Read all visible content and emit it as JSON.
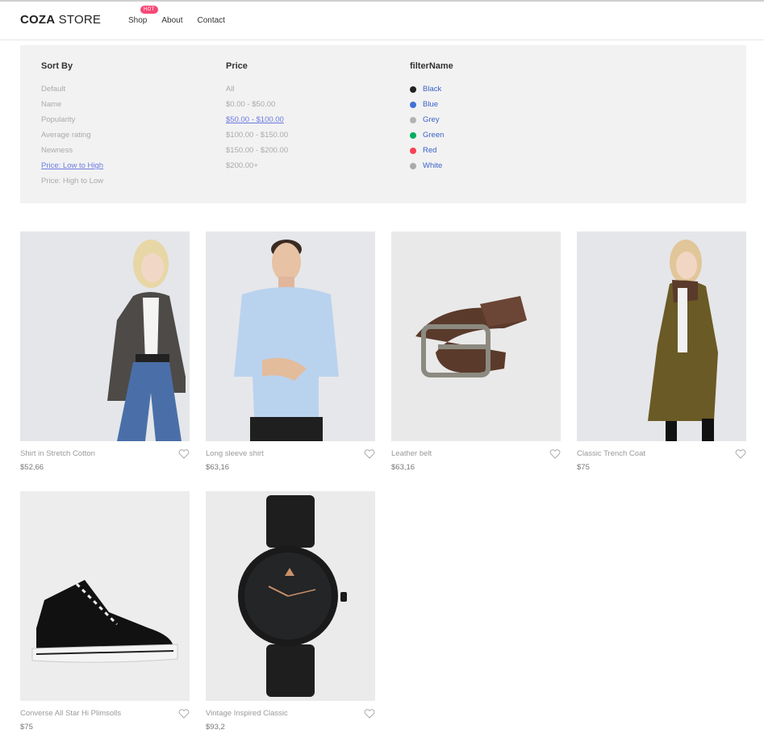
{
  "header": {
    "logo_bold": "COZA",
    "logo_light": " STORE",
    "nav": [
      {
        "label": "Shop",
        "badge": "HOT"
      },
      {
        "label": "About"
      },
      {
        "label": "Contact"
      }
    ]
  },
  "filters": {
    "sort": {
      "title": "Sort By",
      "options": [
        "Default",
        "Name",
        "Popularity",
        "Average rating",
        "Newness",
        "Price: Low to High",
        "Price: High to Low"
      ],
      "active": "Price: Low to High"
    },
    "price": {
      "title": "Price",
      "options": [
        "All",
        "$0.00 - $50.00",
        "$50.00 - $100.00",
        "$100.00 - $150.00",
        "$150.00 - $200.00",
        "$200.00+"
      ],
      "active": "$50.00 - $100.00"
    },
    "color": {
      "title": "filterName",
      "options": [
        {
          "label": "Black",
          "color": "#222222"
        },
        {
          "label": "Blue",
          "color": "#4272d7"
        },
        {
          "label": "Grey",
          "color": "#b3b3b3"
        },
        {
          "label": "Green",
          "color": "#00ad5f"
        },
        {
          "label": "Red",
          "color": "#fa4251"
        },
        {
          "label": "White",
          "color": "#aaaaaa"
        }
      ]
    }
  },
  "products": [
    {
      "name": "Shirt in Stretch Cotton",
      "price": "$52,66",
      "image": "woman-blazer"
    },
    {
      "name": "Long sleeve shirt",
      "price": "$63,16",
      "image": "man-shirt"
    },
    {
      "name": "Leather belt",
      "price": "$63,16",
      "image": "belt"
    },
    {
      "name": "Classic Trench Coat",
      "price": "$75",
      "image": "woman-coat"
    },
    {
      "name": "Converse All Star Hi Plimsolls",
      "price": "$75",
      "image": "sneaker"
    },
    {
      "name": "Vintage Inspired Classic",
      "price": "$93,2",
      "image": "watch"
    }
  ]
}
